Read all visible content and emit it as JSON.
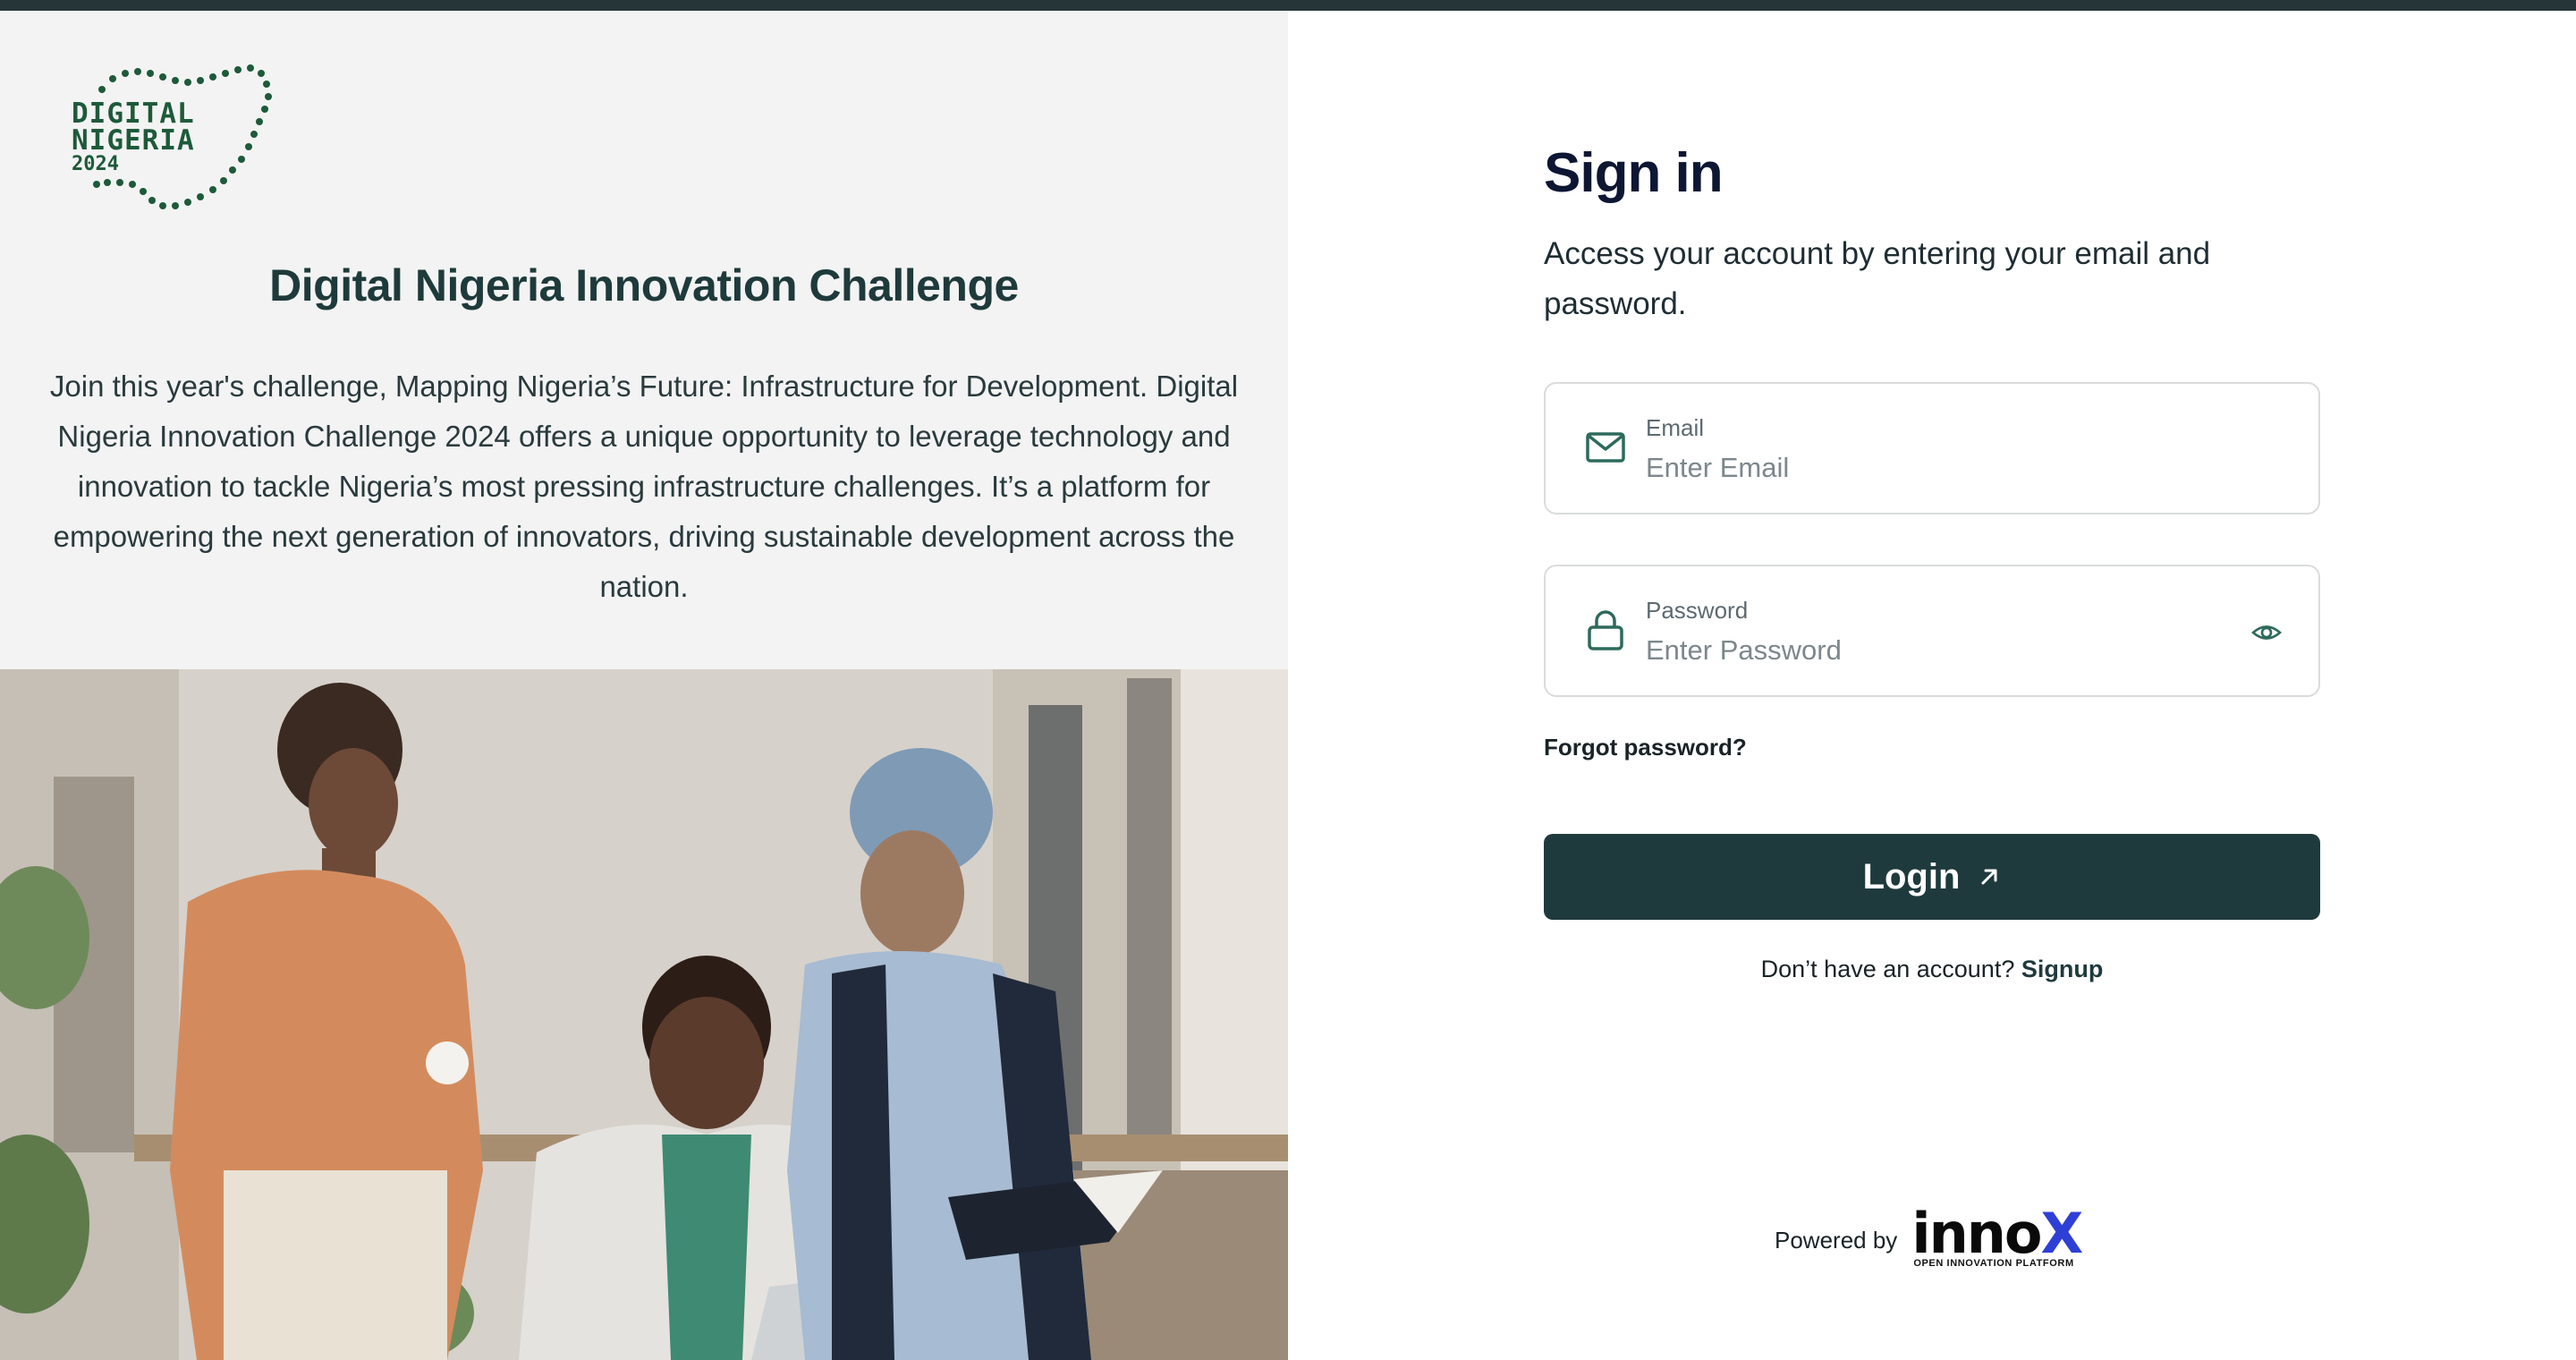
{
  "brand": {
    "logo_line1": "DIGITAL",
    "logo_line2": "NIGERIA",
    "logo_line3": "2024"
  },
  "left": {
    "title": "Digital Nigeria Innovation Challenge",
    "description": "Join this year's challenge, Mapping Nigeria’s Future: Infrastructure for Development. Digital Nigeria Innovation Challenge 2024 offers a unique opportunity to leverage technology and innovation to tackle Nigeria’s most pressing infrastructure challenges. It’s a platform for empowering the next generation of innovators, driving sustainable development across the nation."
  },
  "signin": {
    "title": "Sign in",
    "subtitle": "Access your account by entering your email and password.",
    "email": {
      "label": "Email",
      "placeholder": "Enter Email",
      "value": ""
    },
    "password": {
      "label": "Password",
      "placeholder": "Enter Password",
      "value": ""
    },
    "forgot_label": "Forgot password?",
    "login_label": "Login",
    "no_account_text": "Don’t have an account?",
    "signup_label": "Signup"
  },
  "footer": {
    "powered_by": "Powered by",
    "partner_name": "inno",
    "partner_x": "X",
    "partner_tagline": "OPEN INNOVATION PLATFORM"
  },
  "colors": {
    "accent": "#1f3a3d",
    "brand_green": "#1d5a3a",
    "left_bg": "#f3f3f3",
    "topbar": "#253538",
    "innox_blue": "#2e3fd6"
  },
  "icons": {
    "email": "mail-icon",
    "password": "lock-icon",
    "toggle_password": "eye-icon",
    "login": "arrow-up-right-icon"
  }
}
